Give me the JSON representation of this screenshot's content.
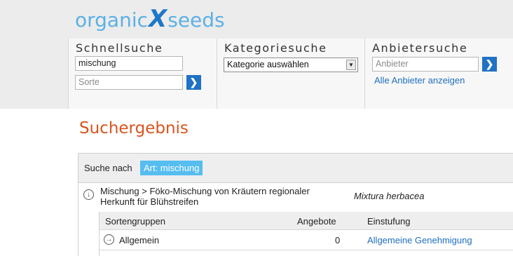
{
  "logo": {
    "part1": "organic",
    "part2": "X",
    "part3": "seeds"
  },
  "quick_search": {
    "title": "Schnellsuche",
    "species_value": "mischung",
    "variety_placeholder": "Sorte"
  },
  "category_search": {
    "title": "Kategoriesuche",
    "select_value": "Kategorie auswählen"
  },
  "supplier_search": {
    "title": "Anbietersuche",
    "placeholder": "Anbieter",
    "all_link": "Alle Anbieter anzeigen"
  },
  "go_icon": "chevron-right-icon",
  "results": {
    "heading": "Suchergebnis",
    "search_label": "Suche nach",
    "search_tag": "Art: mischung",
    "category": {
      "path": "Mischung > Föko-Mischung von Kräutern regionaler Herkunft für Blühstreifen",
      "latin": "Mixtura herbacea"
    },
    "table": {
      "headers": [
        "Sortengruppen",
        "Angebote",
        "Einstufung"
      ],
      "rows": [
        {
          "group": "Allgemein",
          "offers": "0",
          "status": "Allgemeine Genehmigung"
        }
      ]
    }
  },
  "colors": {
    "accent": "#1f72c4",
    "title": "#d9541e",
    "tag": "#56bdf0"
  }
}
